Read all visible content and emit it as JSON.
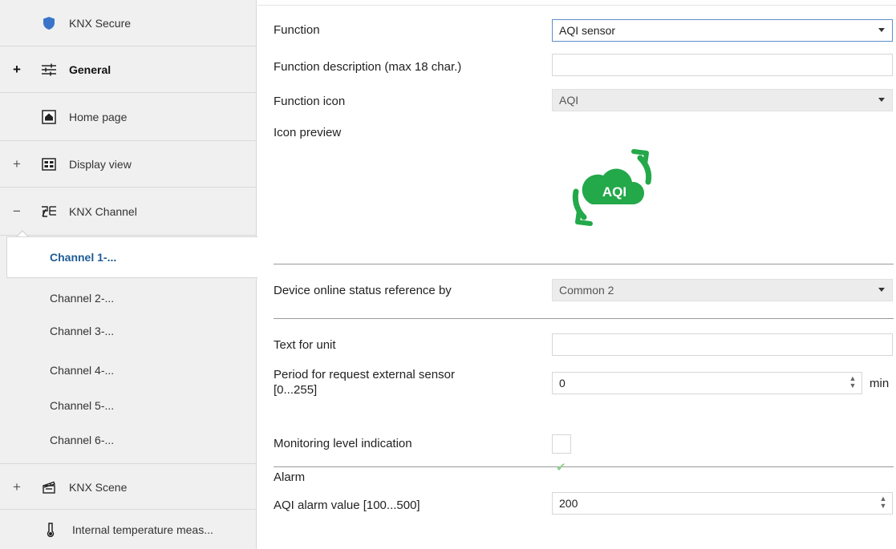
{
  "sidebar": {
    "items": [
      {
        "label": "KNX Secure",
        "icon": "shield-icon",
        "expander": ""
      },
      {
        "label": "General",
        "icon": "sliders-icon",
        "expander": "+"
      },
      {
        "label": "Home page",
        "icon": "home-icon",
        "expander": ""
      },
      {
        "label": "Display view",
        "icon": "display-grid-icon",
        "expander": "+"
      },
      {
        "label": "KNX Channel",
        "icon": "channel-icon",
        "expander": "−"
      }
    ],
    "channels": [
      {
        "label": "Channel 1-..."
      },
      {
        "label": "Channel 2-..."
      },
      {
        "label": "Channel 3-..."
      },
      {
        "label": "Channel 4-..."
      },
      {
        "label": "Channel 5-..."
      },
      {
        "label": "Channel 6-..."
      }
    ],
    "bottom_items": [
      {
        "label": "KNX Scene",
        "icon": "clapperboard-icon",
        "expander": "+"
      },
      {
        "label": "Internal temperature meas...",
        "icon": "thermometer-icon",
        "expander": ""
      }
    ]
  },
  "params": {
    "function": {
      "label": "Function",
      "value": "AQI sensor"
    },
    "function_description": {
      "label": "Function description (max 18 char.)",
      "value": ""
    },
    "function_icon": {
      "label": "Function icon",
      "value": "AQI"
    },
    "icon_preview": {
      "label": "Icon preview",
      "icon_text": "AQI"
    },
    "device_online": {
      "label": "Device online status reference by",
      "value": "Common 2"
    },
    "text_for_unit": {
      "label": "Text for unit",
      "value": ""
    },
    "period": {
      "label_line1": "Period for request external sensor",
      "label_line2": "[0...255]",
      "value": "0",
      "unit": "min"
    },
    "monitoring": {
      "label": "Monitoring level indication",
      "checked": false
    },
    "alarm": {
      "label": "Alarm",
      "checked": true,
      "mark": "✔"
    },
    "aqi_alarm": {
      "label": "AQI alarm value [100...500]",
      "value": "200"
    }
  },
  "colors": {
    "active_channel": "#1e5c96",
    "shield": "#3a74c9",
    "aqi_green": "#23a84a"
  }
}
